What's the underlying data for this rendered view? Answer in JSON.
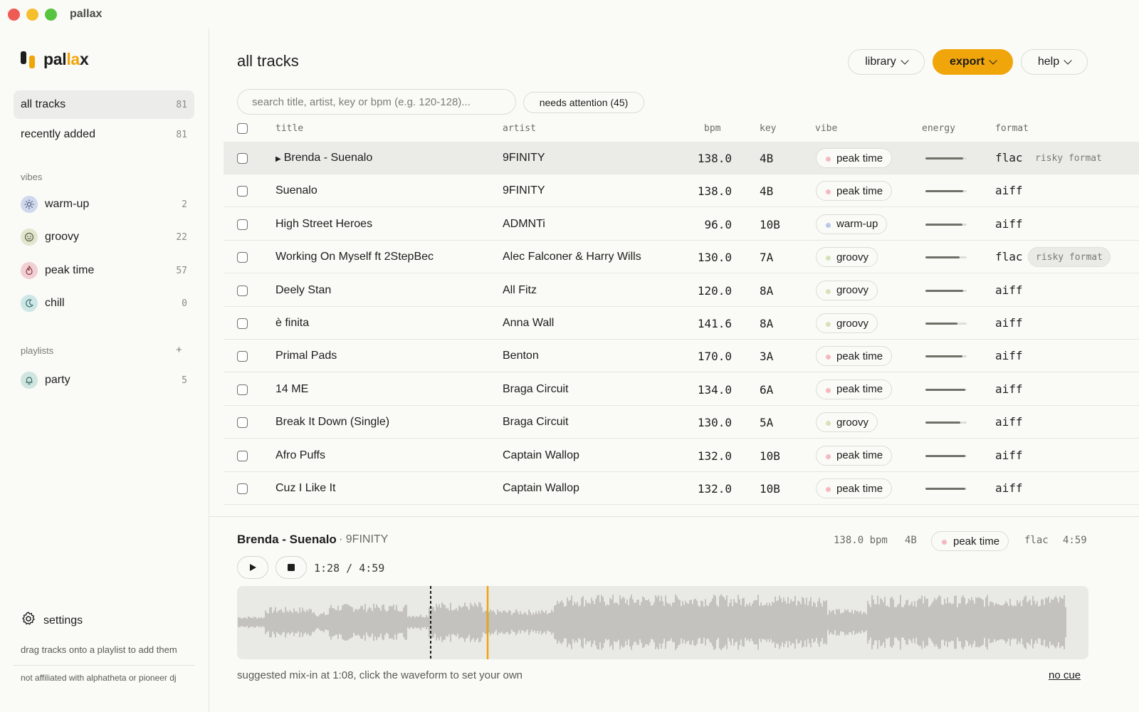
{
  "window": {
    "title": "pallax"
  },
  "brand": {
    "prefix": "pal",
    "accent": "la",
    "suffix": "x"
  },
  "sidebar": {
    "nav": [
      {
        "label": "all tracks",
        "count": "81"
      },
      {
        "label": "recently added",
        "count": "81"
      }
    ],
    "vibes_label": "vibes",
    "vibes": [
      {
        "label": "warm-up",
        "count": "2",
        "icon": "sun-icon",
        "color": "#cfd8ec"
      },
      {
        "label": "groovy",
        "count": "22",
        "icon": "groovy-icon",
        "color": "#e2e6cf"
      },
      {
        "label": "peak time",
        "count": "57",
        "icon": "flame-icon",
        "color": "#f2cfd3"
      },
      {
        "label": "chill",
        "count": "0",
        "icon": "moon-icon",
        "color": "#cde6e6"
      }
    ],
    "playlists_label": "playlists",
    "add_playlist": "+",
    "playlists": [
      {
        "label": "party",
        "count": "5",
        "icon": "bell-icon",
        "color": "#cfe5e0"
      }
    ],
    "settings_label": "settings",
    "hint": "drag tracks onto a playlist to add them",
    "disclaimer": "not affiliated with alphatheta or pioneer dj"
  },
  "main": {
    "title": "all tracks",
    "buttons": {
      "library": "library",
      "export": "export",
      "help": "help"
    },
    "search_placeholder": "search title, artist, key or bpm (e.g. 120-128)...",
    "attention_chip": "needs attention (45)",
    "columns": {
      "title": "title",
      "artist": "artist",
      "bpm": "bpm",
      "key": "key",
      "vibe": "vibe",
      "energy": "energy",
      "format": "format"
    },
    "rows": [
      {
        "title": "Brenda - Suenalo",
        "playing": "▶",
        "artist": "9FINITY",
        "bpm": "138.0",
        "key": "4B",
        "vibe": "peak time",
        "energy": 0.92,
        "format": "flac",
        "risky": "risky format"
      },
      {
        "title": "Suenalo",
        "artist": "9FINITY",
        "bpm": "138.0",
        "key": "4B",
        "vibe": "peak time",
        "energy": 0.92,
        "format": "aiff"
      },
      {
        "title": "High Street Heroes",
        "artist": "ADMNTi",
        "bpm": "96.0",
        "key": "10B",
        "vibe": "warm-up",
        "energy": 0.9,
        "format": "aiff"
      },
      {
        "title": "Working On Myself ft 2StepBec",
        "artist": "Alec Falconer & Harry Wills",
        "bpm": "130.0",
        "key": "7A",
        "vibe": "groovy",
        "energy": 0.82,
        "format": "flac",
        "risky": "risky format"
      },
      {
        "title": "Deely Stan",
        "artist": "All Fitz",
        "bpm": "120.0",
        "key": "8A",
        "vibe": "groovy",
        "energy": 0.92,
        "format": "aiff"
      },
      {
        "title": "è finita",
        "artist": "Anna Wall",
        "bpm": "141.6",
        "key": "8A",
        "vibe": "groovy",
        "energy": 0.77,
        "format": "aiff"
      },
      {
        "title": "Primal Pads",
        "artist": "Benton",
        "bpm": "170.0",
        "key": "3A",
        "vibe": "peak time",
        "energy": 0.9,
        "format": "aiff"
      },
      {
        "title": "14 ME",
        "artist": "Braga Circuit",
        "bpm": "134.0",
        "key": "6A",
        "vibe": "peak time",
        "energy": 0.97,
        "format": "aiff"
      },
      {
        "title": "Break It Down (Single)",
        "artist": "Braga Circuit",
        "bpm": "130.0",
        "key": "5A",
        "vibe": "groovy",
        "energy": 0.85,
        "format": "aiff"
      },
      {
        "title": "Afro Puffs",
        "artist": "Captain Wallop",
        "bpm": "132.0",
        "key": "10B",
        "vibe": "peak time",
        "energy": 0.97,
        "format": "aiff"
      },
      {
        "title": "Cuz I Like It",
        "artist": "Captain Wallop",
        "bpm": "132.0",
        "key": "10B",
        "vibe": "peak time",
        "energy": 0.97,
        "format": "aiff"
      }
    ]
  },
  "vibe_colors": {
    "peak time": "#f2b9bf",
    "warm-up": "#b8c8e8",
    "groovy": "#d6e2b8",
    "chill": "#b9dede"
  },
  "player": {
    "title": "Brenda - Suenalo",
    "artist": "· 9FINITY",
    "bpm": "138.0 bpm",
    "key": "4B",
    "vibe": "peak time",
    "format": "flac",
    "duration": "4:59",
    "time": "1:28  /  4:59",
    "suggestion": "suggested mix-in at 1:08, click the waveform to set your own",
    "no_cue": "no cue",
    "colors": {
      "accent": "#f0a50a",
      "wave": "#9e9c96"
    }
  }
}
